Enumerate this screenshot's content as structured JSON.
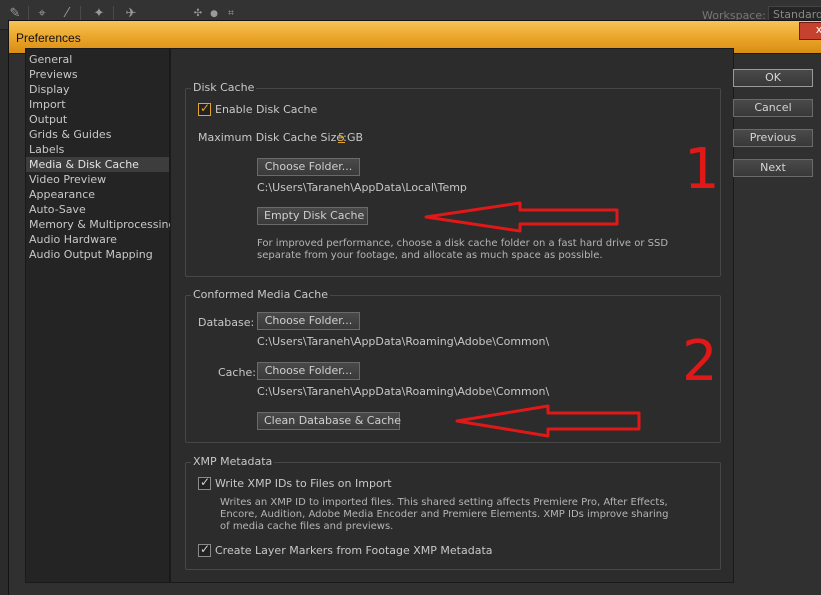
{
  "workspace": {
    "label": "Workspace:",
    "value": "Standard"
  },
  "dialog": {
    "title": "Preferences",
    "close": "x"
  },
  "categories": [
    "General",
    "Previews",
    "Display",
    "Import",
    "Output",
    "Grids & Guides",
    "Labels",
    "Media & Disk Cache",
    "Video Preview",
    "Appearance",
    "Auto-Save",
    "Memory & Multiprocessing",
    "Audio Hardware",
    "Audio Output Mapping"
  ],
  "selected_category": "Media & Disk Cache",
  "disk_cache": {
    "title": "Disk Cache",
    "enable_label": "Enable Disk Cache",
    "enable_checked": true,
    "max_size_label": "Maximum Disk Cache Size:",
    "max_size_value": "5",
    "max_size_unit": "GB",
    "choose_folder": "Choose Folder...",
    "path": "C:\\Users\\Taraneh\\AppData\\Local\\Temp",
    "empty_button": "Empty Disk Cache",
    "info": "For improved performance, choose a disk cache folder on a fast hard drive or SSD separate from your footage, and allocate as much space as possible."
  },
  "conformed_cache": {
    "title": "Conformed Media Cache",
    "database_label": "Database:",
    "database_button": "Choose Folder...",
    "database_path": "C:\\Users\\Taraneh\\AppData\\Roaming\\Adobe\\Common\\",
    "cache_label": "Cache:",
    "cache_button": "Choose Folder...",
    "cache_path": "C:\\Users\\Taraneh\\AppData\\Roaming\\Adobe\\Common\\",
    "clean_button": "Clean Database & Cache"
  },
  "xmp": {
    "title": "XMP Metadata",
    "write_label": "Write XMP IDs to Files on Import",
    "write_checked": true,
    "write_info": "Writes an XMP ID to imported files. This shared setting affects Premiere Pro, After Effects, Encore, Audition, Adobe Media Encoder and Premiere Elements. XMP IDs improve sharing of media cache files and previews.",
    "markers_label": "Create Layer Markers from Footage XMP Metadata",
    "markers_checked": true
  },
  "buttons": {
    "ok": "OK",
    "cancel": "Cancel",
    "previous": "Previous",
    "next": "Next"
  },
  "annotations": {
    "marker1": "1",
    "marker2": "2",
    "color": "#e01818"
  },
  "accent_color": "#e5a52d"
}
